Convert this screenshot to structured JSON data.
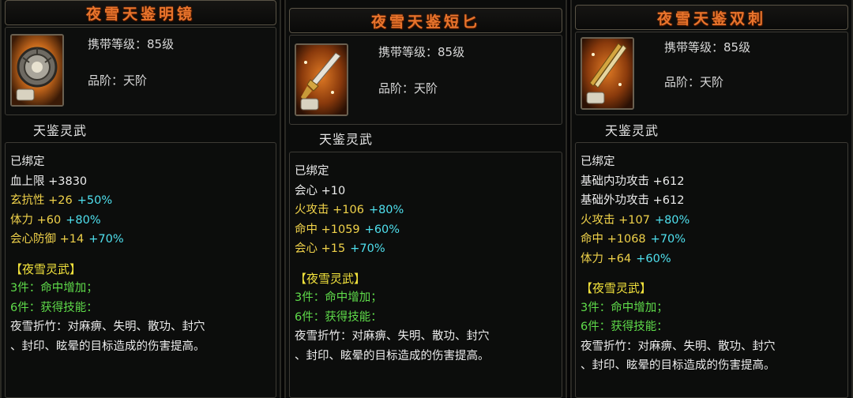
{
  "items": [
    {
      "name": "夜雪天鉴明镜",
      "level_label": "携带等级：",
      "level_value": "85级",
      "grade_label": "品阶：",
      "grade_value": "天阶",
      "category": "天鉴灵武",
      "bound": "已绑定",
      "icon": "mirror-weapon-icon",
      "stats": [
        {
          "name": "血上限",
          "base": "+3830",
          "bonus": ""
        },
        {
          "name": "玄抗性",
          "base": "+26",
          "bonus": "+50%"
        },
        {
          "name": "体力",
          "base": "+60",
          "bonus": "+80%"
        },
        {
          "name": "会心防御",
          "base": "+14",
          "bonus": "+70%"
        }
      ],
      "set_name": "【夜雪灵武】",
      "set_3": "3件：命中增加；",
      "set_6": "6件：获得技能：",
      "skill_line1": "夜雪折竹：对麻痹、失明、散功、封穴",
      "skill_line2": "、封印、眩晕的目标造成的伤害提高。"
    },
    {
      "name": "夜雪天鉴短匕",
      "level_label": "携带等级：",
      "level_value": "85级",
      "grade_label": "品阶：",
      "grade_value": "天阶",
      "category": "天鉴灵武",
      "bound": "已绑定",
      "icon": "dagger-weapon-icon",
      "stats": [
        {
          "name": "会心",
          "base": "+10",
          "bonus": ""
        },
        {
          "name": "火攻击",
          "base": "+106",
          "bonus": "+80%"
        },
        {
          "name": "命中",
          "base": "+1059",
          "bonus": "+60%"
        },
        {
          "name": "会心",
          "base": "+15",
          "bonus": "+70%"
        }
      ],
      "set_name": "【夜雪灵武】",
      "set_3": "3件：命中增加；",
      "set_6": "6件：获得技能：",
      "skill_line1": "夜雪折竹：对麻痹、失明、散功、封穴",
      "skill_line2": "、封印、眩晕的目标造成的伤害提高。"
    },
    {
      "name": "夜雪天鉴双刺",
      "level_label": "携带等级：",
      "level_value": "85级",
      "grade_label": "品阶：",
      "grade_value": "天阶",
      "category": "天鉴灵武",
      "bound": "已绑定",
      "icon": "twin-spike-weapon-icon",
      "stats": [
        {
          "name": "基础内功攻击",
          "base": "+612",
          "bonus": ""
        },
        {
          "name": "基础外功攻击",
          "base": "+612",
          "bonus": ""
        },
        {
          "name": "火攻击",
          "base": "+107",
          "bonus": "+80%"
        },
        {
          "name": "命中",
          "base": "+1068",
          "bonus": "+70%"
        },
        {
          "name": "体力",
          "base": "+64",
          "bonus": "+60%"
        }
      ],
      "set_name": "【夜雪灵武】",
      "set_3": "3件：命中增加；",
      "set_6": "6件：获得技能：",
      "skill_line1": "夜雪折竹：对麻痹、失明、散功、封穴",
      "skill_line2": "、封印、眩晕的目标造成的伤害提高。"
    }
  ],
  "colors": {
    "title": "#e8742c",
    "yellow_stat": "#f0d24a",
    "bonus_cyan": "#4fe0ee",
    "set_green": "#5fdc4a",
    "set_title": "#f2e23c"
  }
}
